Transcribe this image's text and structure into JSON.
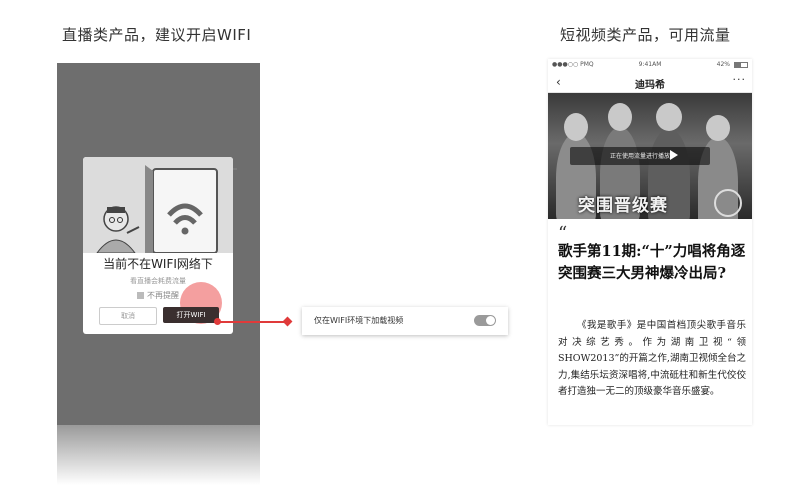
{
  "titles": {
    "left": "直播类产品，建议开启WIFI",
    "right": "短视频类产品，可用流量"
  },
  "dialog": {
    "heading": "当前不在WIFI网络下",
    "description": "看直播会耗费流量",
    "no_remind": "不再提醒",
    "cancel_label": "取消",
    "open_wifi_label": "打开WIFI"
  },
  "setting": {
    "label": "仅在WIFI环境下加载视频",
    "toggle_on": true
  },
  "right_phone": {
    "status": {
      "carrier": "●●●○○ PMQ",
      "time": "9:41AM",
      "battery": "42%"
    },
    "nav": {
      "title": "迪玛希",
      "back_icon": "‹",
      "more_icon": "···"
    },
    "video": {
      "tip": "正在使用流量进行播放",
      "caption": "突围晋级赛"
    },
    "article": {
      "quote": "“",
      "title": "歌手第11期:“十”力唱将角逐突围赛三大男神爆冷出局?",
      "body": "《我是歌手》是中国首档顶尖歌手音乐对决综艺秀。作为湖南卫视“领SHOW2013”的开篇之作,湖南卫视倾全台之力,集结乐坛资深唱将,中流砥柱和新生代佼佼者打造独一无二的顶级豪华音乐盛宴。"
    }
  },
  "colors": {
    "accent": "#e03a3a",
    "button_dark": "#3a2f2f",
    "phone_bg": "#6e6e6e"
  }
}
